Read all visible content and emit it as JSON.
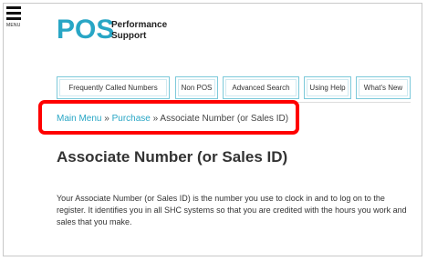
{
  "header": {
    "menu_label": "MENU",
    "logo": "POS",
    "tagline_line1": "Performance",
    "tagline_line2": "Support"
  },
  "nav": {
    "items": [
      {
        "label": "Frequently Called Numbers"
      },
      {
        "label": "Non POS"
      },
      {
        "label": "Advanced Search"
      },
      {
        "label": "Using Help"
      },
      {
        "label": "What's New"
      }
    ]
  },
  "breadcrumb": {
    "main_menu": "Main Menu",
    "sep1": " » ",
    "purchase": "Purchase",
    "sep2": " » ",
    "current": "Associate Number (or Sales ID)"
  },
  "page": {
    "title": "Associate Number (or Sales ID)",
    "body": "Your Associate Number (or Sales ID) is the number you use to clock in and to log on to the register.  It identifies you in all SHC systems so that you are credited with the hours you work and sales that you make."
  },
  "colors": {
    "accent": "#28a6c5",
    "highlight": "#ff0000"
  }
}
